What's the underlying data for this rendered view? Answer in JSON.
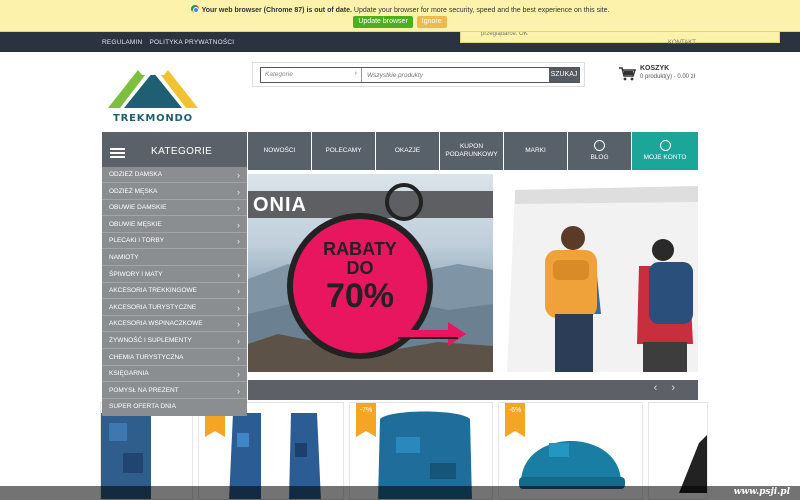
{
  "browser_warning": {
    "bold": "Your web browser (Chrome 87) is out of date.",
    "text": "Update your browser for more security, speed and the best experience on this site.",
    "update_label": "Update browser",
    "ignore_label": "Ignore"
  },
  "top_links": [
    "REGULAMIN",
    "POLITYKA PRYWATNOŚCI"
  ],
  "cookie_text": "przeglądarce. OK",
  "contact_label": "KONTAKT",
  "logo": {
    "brand": "TREKMONDO"
  },
  "search": {
    "category_placeholder": "Kategorie",
    "query_placeholder": "Wszystkie produkty",
    "button_label": "SZUKAJ"
  },
  "cart": {
    "label": "KOSZYK",
    "summary": "0 produkt(y) - 0.00 zł"
  },
  "nav": {
    "categories_title": "KATEGORIE",
    "items": [
      "NOWOŚCI",
      "POLECAMY",
      "OKAZJE",
      "KUPON PODARUNKOWY",
      "MARKI",
      "BLOG",
      "MOJE KONTO"
    ]
  },
  "categories": [
    "ODZIEŻ DAMSKA",
    "ODZIEŻ MĘSKA",
    "OBUWIE DAMSKIE",
    "OBUWIE MĘSKIE",
    "PLECAKI I TORBY",
    "NAMIOTY",
    "ŚPIWORY I MATY",
    "AKCESORIA TREKKINGOWE",
    "AKCESORIA TURYSTYCZNE",
    "AKCESORIA WSPINACZKOWE",
    "ŻYWNOŚĆ I SUPLEMENTY",
    "CHEMIA TURYSTYCZNA",
    "KSIĘGARNIA",
    "POMYSŁ NA PREZENT",
    "SUPER OFERTA DNIA"
  ],
  "banner": {
    "stripe_text": "ONIA",
    "tag_line1": "RABATY",
    "tag_line2": "DO",
    "tag_line3": "70%"
  },
  "products": [
    {
      "badge": ""
    },
    {
      "badge": "-6%"
    },
    {
      "badge": "-7%"
    },
    {
      "badge": "-6%"
    },
    {
      "badge": ""
    }
  ],
  "watermark": "www.psji.pl",
  "colors": {
    "accent_teal": "#1aa79a",
    "nav_gray": "#58606a",
    "badge_orange": "#f4a524",
    "sale_pink": "#e8165f"
  }
}
